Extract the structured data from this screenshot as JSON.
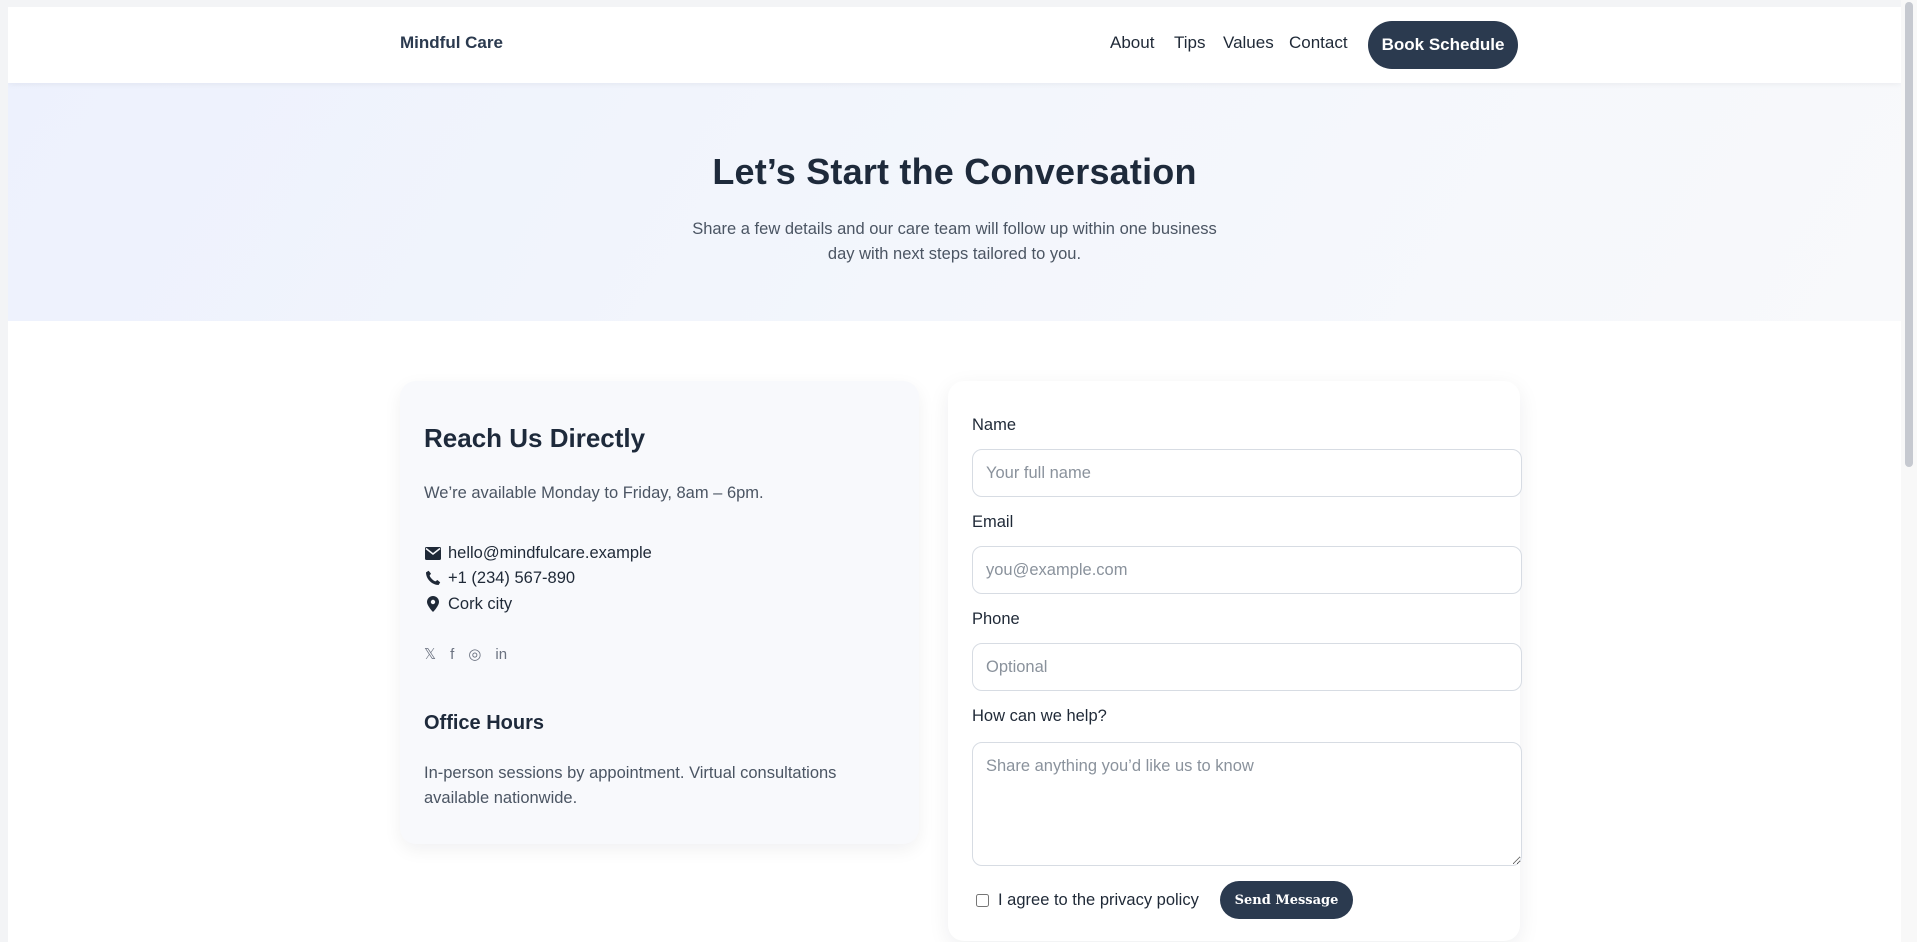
{
  "header": {
    "brand": "Mindful Care",
    "nav": {
      "about": "About",
      "tips": "Tips",
      "values": "Values",
      "contact": "Contact"
    },
    "cta": "Book Schedule"
  },
  "hero": {
    "title": "Let’s Start the Conversation",
    "subtitle": "Share a few details and our care team will follow up within one business day with next steps tailored to you."
  },
  "info": {
    "title": "Reach Us Directly",
    "availability": "We’re available Monday to Friday, 8am – 6pm.",
    "email": "hello@mindfulcare.example",
    "phone": "+1 (234) 567-890",
    "location": "Cork city",
    "socials": {
      "x": "𝕏",
      "facebook": "f",
      "instagram": "◎",
      "linkedin": "in"
    },
    "office_title": "Office Hours",
    "office_text": "In-person sessions by appointment. Virtual consultations available nationwide."
  },
  "form": {
    "name_label": "Name",
    "name_placeholder": "Your full name",
    "email_label": "Email",
    "email_placeholder": "you@example.com",
    "phone_label": "Phone",
    "phone_placeholder": "Optional",
    "help_label": "How can we help?",
    "help_placeholder": "Share anything you’d like us to know",
    "agree_label": "I agree to the privacy policy",
    "submit": "Send Message"
  },
  "icons": {
    "email": "envelope-icon",
    "phone": "phone-icon",
    "location": "map-pin-icon"
  },
  "colors": {
    "primary": "#2b3a4f",
    "heading": "#1e2a3b",
    "muted": "#4b5563",
    "hero_bg": "#edf1fd",
    "card_bg": "#f8f9fc"
  }
}
